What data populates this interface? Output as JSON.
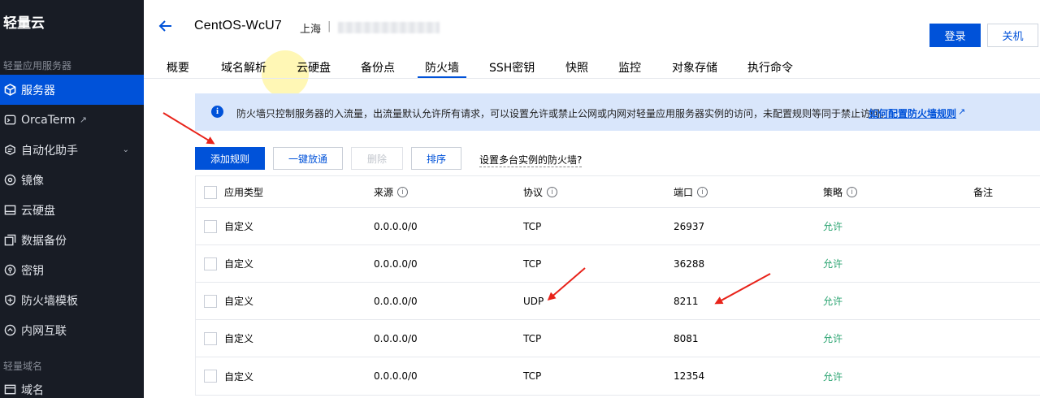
{
  "sidebar": {
    "brand": "轻量云",
    "section1_title": "轻量应用服务器",
    "items": [
      {
        "label": "服务器",
        "icon": "cube-icon",
        "active": true
      },
      {
        "label": "OrcaTerm",
        "icon": "terminal-icon",
        "external": true
      },
      {
        "label": "自动化助手",
        "icon": "assistant-icon",
        "expandable": true
      },
      {
        "label": "镜像",
        "icon": "disc-icon"
      },
      {
        "label": "云硬盘",
        "icon": "disk-icon"
      },
      {
        "label": "数据备份",
        "icon": "backup-icon"
      },
      {
        "label": "密钥",
        "icon": "key-icon"
      },
      {
        "label": "防火墙模板",
        "icon": "shield-icon"
      },
      {
        "label": "内网互联",
        "icon": "network-icon"
      }
    ],
    "section2_title": "轻量域名",
    "items2": [
      {
        "label": "域名",
        "icon": "domain-icon"
      }
    ]
  },
  "header": {
    "instance_name": "CentOS-WcU7",
    "region": "上海",
    "separator": "|",
    "login_label": "登录",
    "shutdown_label": "关机"
  },
  "tabs": [
    {
      "label": "概要"
    },
    {
      "label": "域名解析"
    },
    {
      "label": "云硬盘"
    },
    {
      "label": "备份点"
    },
    {
      "label": "防火墙",
      "active": true
    },
    {
      "label": "SSH密钥"
    },
    {
      "label": "快照"
    },
    {
      "label": "监控"
    },
    {
      "label": "对象存储"
    },
    {
      "label": "执行命令"
    }
  ],
  "info": {
    "text": "防火墙只控制服务器的入流量，出流量默认允许所有请求，可以设置允许或禁止公网或内网对轻量应用服务器实例的访问，未配置规则等同于禁止访问。",
    "link": "如何配置防火墙规则"
  },
  "actions": {
    "add_rule": "添加规则",
    "one_click": "一键放通",
    "delete": "删除",
    "sort": "排序",
    "multi_instance": "设置多台实例的防火墙?"
  },
  "table": {
    "columns": [
      "应用类型",
      "来源",
      "协议",
      "端口",
      "策略",
      "备注"
    ],
    "rows": [
      {
        "type": "自定义",
        "source": "0.0.0.0/0",
        "protocol": "TCP",
        "port": "26937",
        "policy": "允许",
        "note": ""
      },
      {
        "type": "自定义",
        "source": "0.0.0.0/0",
        "protocol": "TCP",
        "port": "36288",
        "policy": "允许",
        "note": ""
      },
      {
        "type": "自定义",
        "source": "0.0.0.0/0",
        "protocol": "UDP",
        "port": "8211",
        "policy": "允许",
        "note": ""
      },
      {
        "type": "自定义",
        "source": "0.0.0.0/0",
        "protocol": "TCP",
        "port": "8081",
        "policy": "允许",
        "note": ""
      },
      {
        "type": "自定义",
        "source": "0.0.0.0/0",
        "protocol": "TCP",
        "port": "12354",
        "policy": "允许",
        "note": ""
      }
    ]
  },
  "colors": {
    "sidebar_bg": "#181c25",
    "accent": "#0052d9",
    "allow": "#2ba471",
    "annotation": "#e8231a"
  }
}
